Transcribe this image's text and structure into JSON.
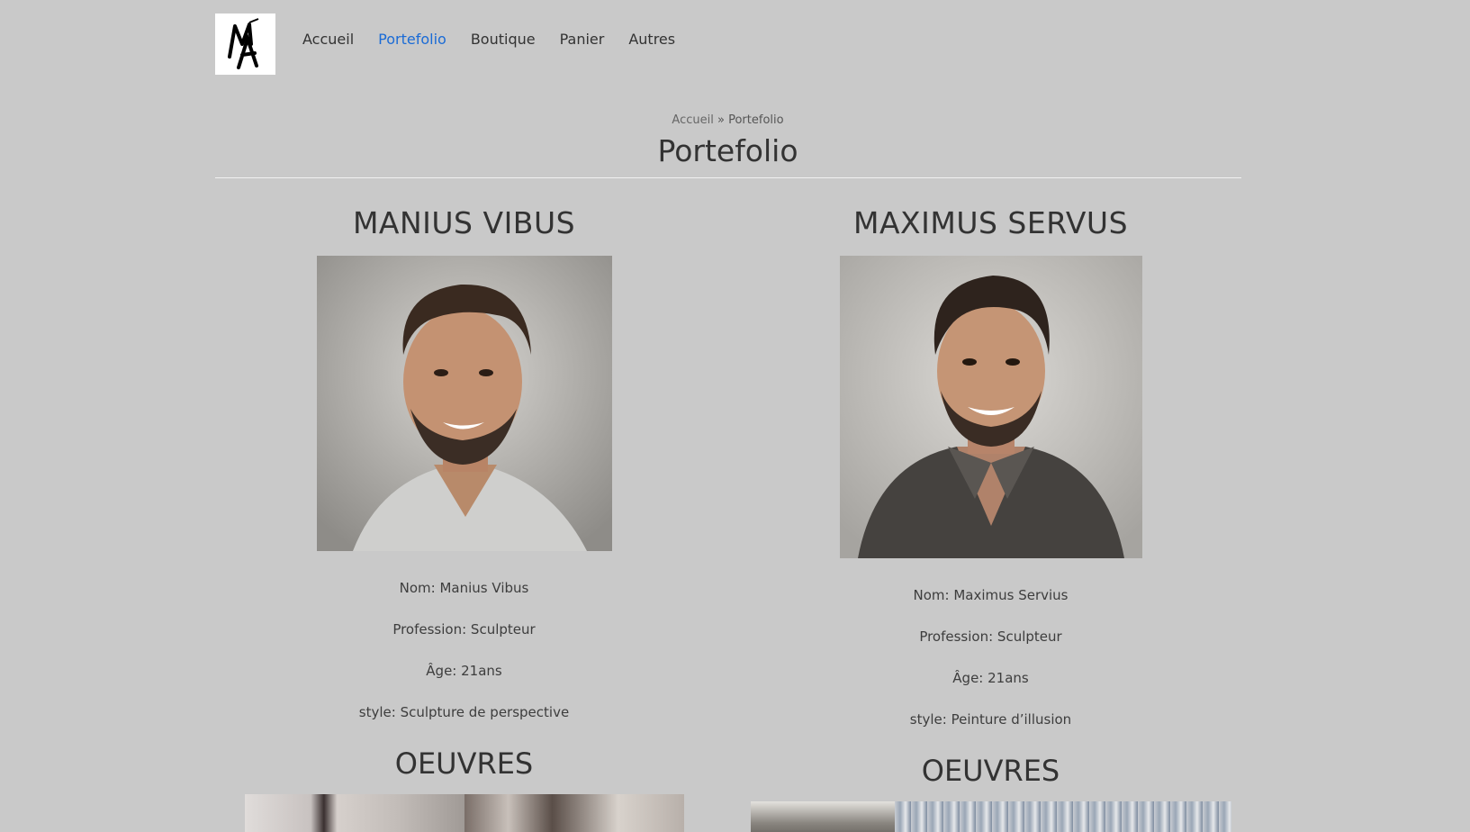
{
  "header": {
    "logo_alt": "MA",
    "nav": [
      {
        "label": "Accueil",
        "active": false
      },
      {
        "label": "Portefolio",
        "active": true
      },
      {
        "label": "Boutique",
        "active": false
      },
      {
        "label": "Panier",
        "active": false
      },
      {
        "label": "Autres",
        "active": false
      }
    ]
  },
  "breadcrumb": {
    "home": "Accueil",
    "separator": "»",
    "current": "Portefolio"
  },
  "page_title": "Portefolio",
  "artists": [
    {
      "name": "MANIUS VIBUS",
      "nom": "Nom: Manius Vibus",
      "profession": "Profession: Sculpteur",
      "age": "Âge: 21ans",
      "style": "style: Sculpture de perspective",
      "works_title": "OEUVRES"
    },
    {
      "name": "MAXIMUS SERVUS",
      "nom": "Nom: Maximus Servius",
      "profession": "Profession: Sculpteur",
      "age": "Âge: 21ans",
      "style": "style: Peinture d’illusion",
      "works_title": "OEUVRES"
    }
  ],
  "colors": {
    "accent": "#1a6bd6",
    "background": "#c9c9c9",
    "text": "#333333"
  }
}
